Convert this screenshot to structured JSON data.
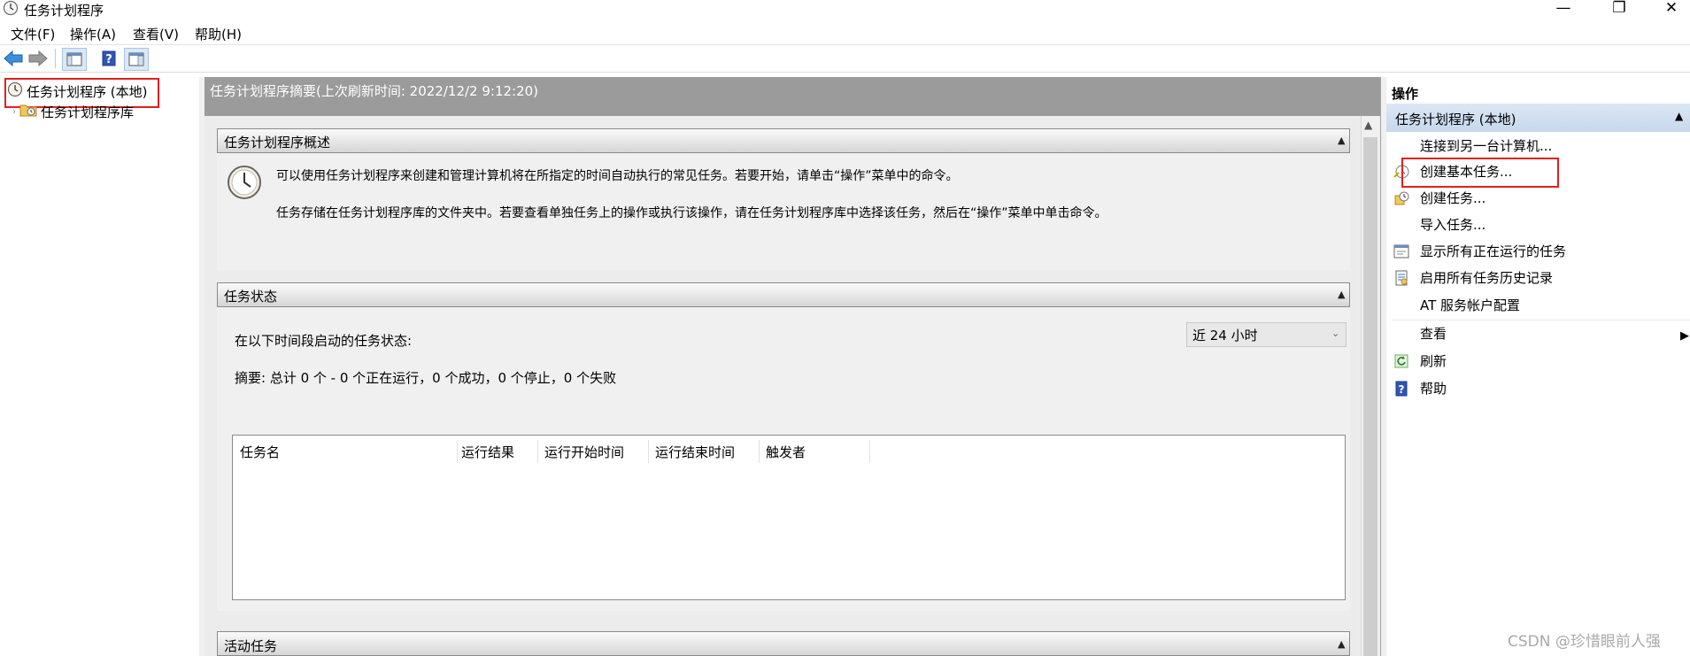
{
  "window": {
    "title": "任务计划程序"
  },
  "menu": [
    "文件(F)",
    "操作(A)",
    "查看(V)",
    "帮助(H)"
  ],
  "tree": {
    "root": "任务计划程序 (本地)",
    "child": "任务计划程序库"
  },
  "center": {
    "header": "任务计划程序摘要(上次刷新时间: 2022/12/2 9:12:20)",
    "overview": {
      "title": "任务计划程序概述",
      "line1": "可以使用任务计划程序来创建和管理计算机将在所指定的时间自动执行的常见任务。若要开始，请单击“操作”菜单中的命令。",
      "line2": "任务存储在任务计划程序库的文件夹中。若要查看单独任务上的操作或执行该操作，请在任务计划程序库中选择该任务，然后在“操作”菜单中单击命令。"
    },
    "status": {
      "title": "任务状态",
      "label": "在以下时间段启动的任务状态:",
      "range": "近 24 小时",
      "summary": "摘要: 总计 0 个 - 0 个正在运行，0 个成功，0 个停止，0 个失败",
      "columns": [
        "任务名",
        "运行结果",
        "运行开始时间",
        "运行结束时间",
        "触发者"
      ]
    },
    "active": {
      "title": "活动任务"
    }
  },
  "actions": {
    "title": "操作",
    "group": "任务计划程序 (本地)",
    "items": [
      "连接到另一台计算机...",
      "创建基本任务...",
      "创建任务...",
      "导入任务...",
      "显示所有正在运行的任务",
      "启用所有任务历史记录",
      "AT 服务帐户配置",
      "查看",
      "刷新",
      "帮助"
    ]
  },
  "watermark": "CSDN @珍惜眼前人强",
  "colors": {
    "highlight": "#e02020",
    "header_gray": "#9b9b9b",
    "group_blue": "#c7d8ec"
  }
}
